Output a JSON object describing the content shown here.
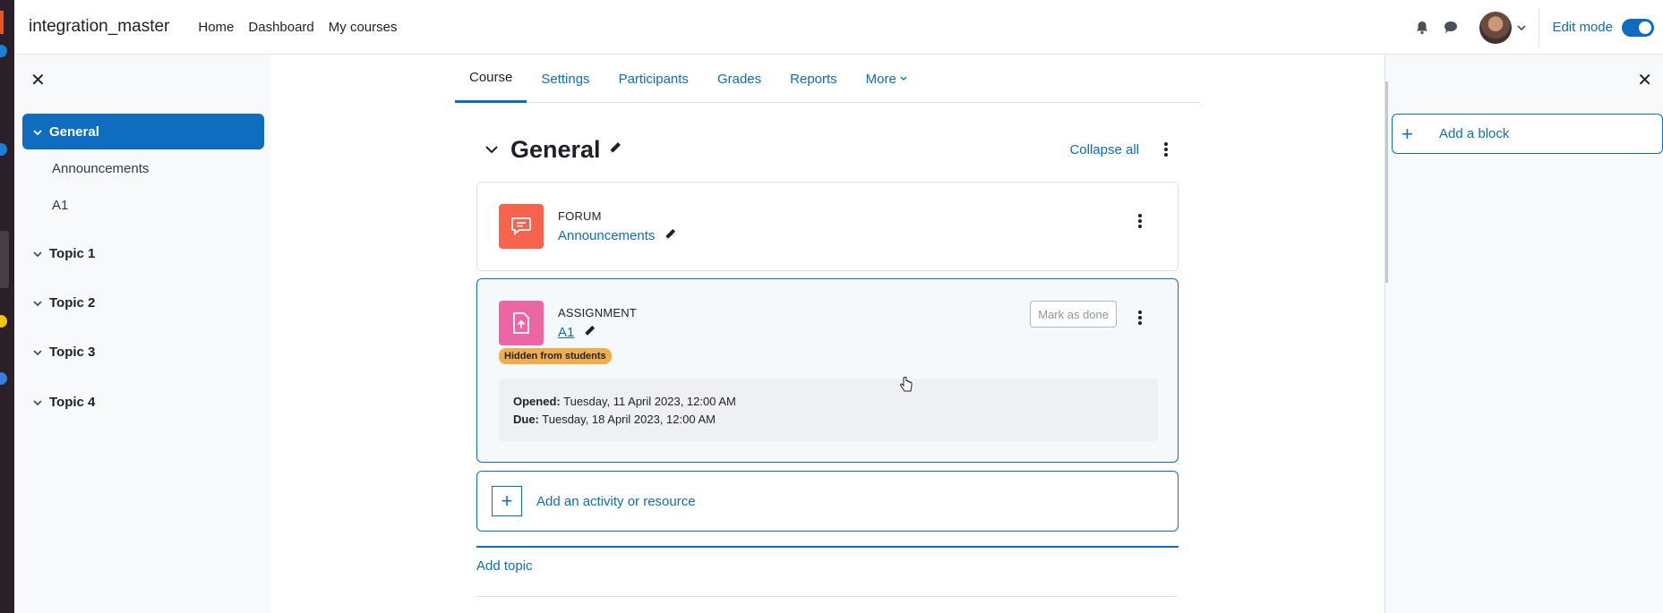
{
  "site": {
    "name": "integration_master"
  },
  "nav": {
    "links": [
      "Home",
      "Dashboard",
      "My courses"
    ]
  },
  "header": {
    "edit_mode_label": "Edit mode"
  },
  "index": {
    "sections": [
      {
        "label": "General",
        "items": [
          "Announcements",
          "A1"
        ]
      },
      {
        "label": "Topic 1"
      },
      {
        "label": "Topic 2"
      },
      {
        "label": "Topic 3"
      },
      {
        "label": "Topic 4"
      }
    ]
  },
  "tabs": [
    "Course",
    "Settings",
    "Participants",
    "Grades",
    "Reports",
    "More"
  ],
  "section": {
    "title": "General",
    "collapse_all": "Collapse all"
  },
  "activities": [
    {
      "type": "FORUM",
      "name": "Announcements",
      "color": "#f7634d"
    },
    {
      "type": "ASSIGNMENT",
      "name": "A1",
      "color": "#eb66a2",
      "mark_done": "Mark as done",
      "badge": "Hidden from students",
      "opened_label": "Opened:",
      "opened": "Tuesday, 11 April 2023, 12:00 AM",
      "due_label": "Due:",
      "due": "Tuesday, 18 April 2023, 12:00 AM"
    }
  ],
  "add_activity": "Add an activity or resource",
  "add_topic": "Add topic",
  "blocks": {
    "add_block": "Add a block"
  },
  "colors": {
    "accent": "#0f6cbf",
    "badge": "#f0ad4e"
  }
}
